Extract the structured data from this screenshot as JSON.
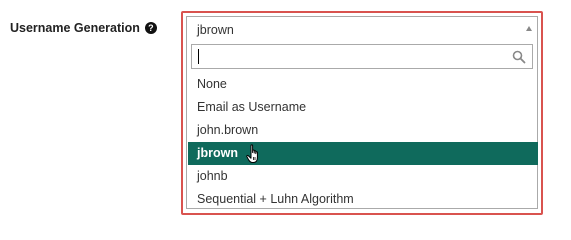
{
  "field": {
    "label": "Username Generation",
    "help_icon": "?"
  },
  "select": {
    "value": "jbrown",
    "arrow_icon": "arrow-up-icon"
  },
  "search": {
    "value": "",
    "placeholder": "",
    "icon": "search-icon"
  },
  "options": [
    {
      "label": "None",
      "selected": false
    },
    {
      "label": "Email as Username",
      "selected": false
    },
    {
      "label": "john.brown",
      "selected": false
    },
    {
      "label": "jbrown",
      "selected": true
    },
    {
      "label": "johnb",
      "selected": false
    },
    {
      "label": "Sequential + Luhn Algorithm",
      "selected": false
    }
  ],
  "colors": {
    "highlight_border": "#d9534f",
    "selected_bg": "#0f6a5c",
    "selected_text": "#ffffff"
  },
  "cursor_icon": "hand-pointer-icon"
}
